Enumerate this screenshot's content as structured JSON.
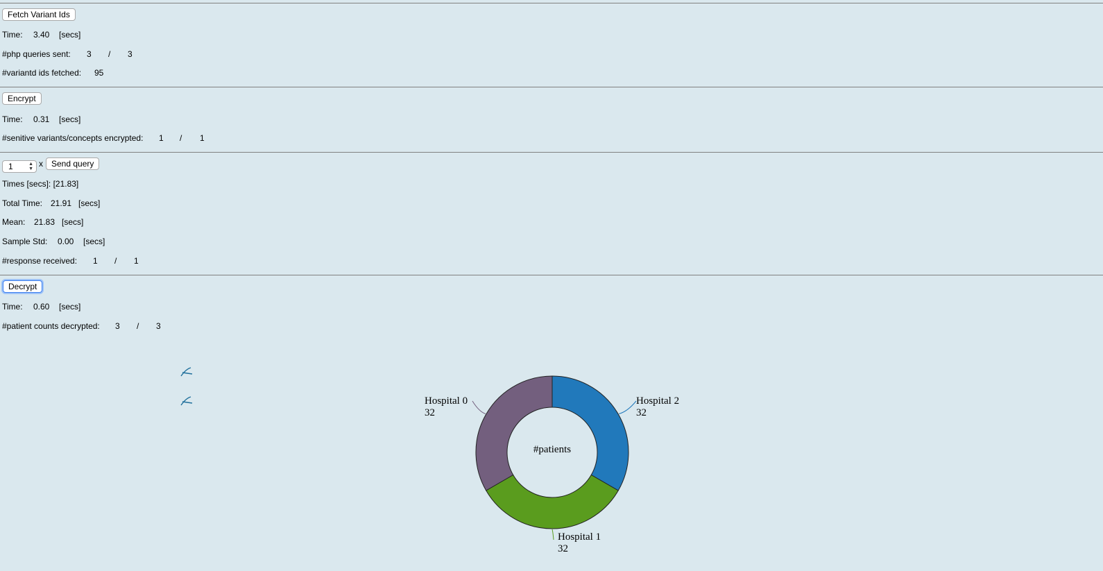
{
  "fetch": {
    "button_label": "Fetch Variant Ids",
    "time_label": "Time:",
    "time_value": "3.40",
    "time_unit": "[secs]",
    "php_label": "#php queries sent:",
    "php_sent": "3",
    "php_sep": "/",
    "php_total": "3",
    "variant_label": "#variantd ids fetched:",
    "variant_count": "95"
  },
  "encrypt": {
    "button_label": "Encrypt",
    "time_label": "Time:",
    "time_value": "0.31",
    "time_unit": "[secs]",
    "sensitive_label": "#senitive variants/concepts encrypted:",
    "sensitive_done": "1",
    "sensitive_sep": "/",
    "sensitive_total": "1"
  },
  "query": {
    "repeat_value": "1",
    "times_sign": "x",
    "send_label": "Send query",
    "times_text": "Times [secs]: [21.83]",
    "total_label": "Total Time:",
    "total_value": "21.91",
    "total_unit": "[secs]",
    "mean_label": "Mean:",
    "mean_value": "21.83",
    "mean_unit": "[secs]",
    "std_label": "Sample Std:",
    "std_value": "0.00",
    "std_unit": "[secs]",
    "resp_label": "#response received:",
    "resp_done": "1",
    "resp_sep": "/",
    "resp_total": "1"
  },
  "decrypt": {
    "button_label": "Decrypt",
    "time_label": "Time:",
    "time_value": "0.60",
    "time_unit": "[secs]",
    "count_label": "#patient counts decrypted:",
    "count_done": "3",
    "count_sep": "/",
    "count_total": "3"
  },
  "chart_data": {
    "type": "pie",
    "title": "#patients",
    "categories": [
      "Hospital 2",
      "Hospital 1",
      "Hospital 0"
    ],
    "values": [
      32,
      32,
      32
    ],
    "colors": [
      "#2179bb",
      "#5a9c1e",
      "#735f7e"
    ]
  }
}
